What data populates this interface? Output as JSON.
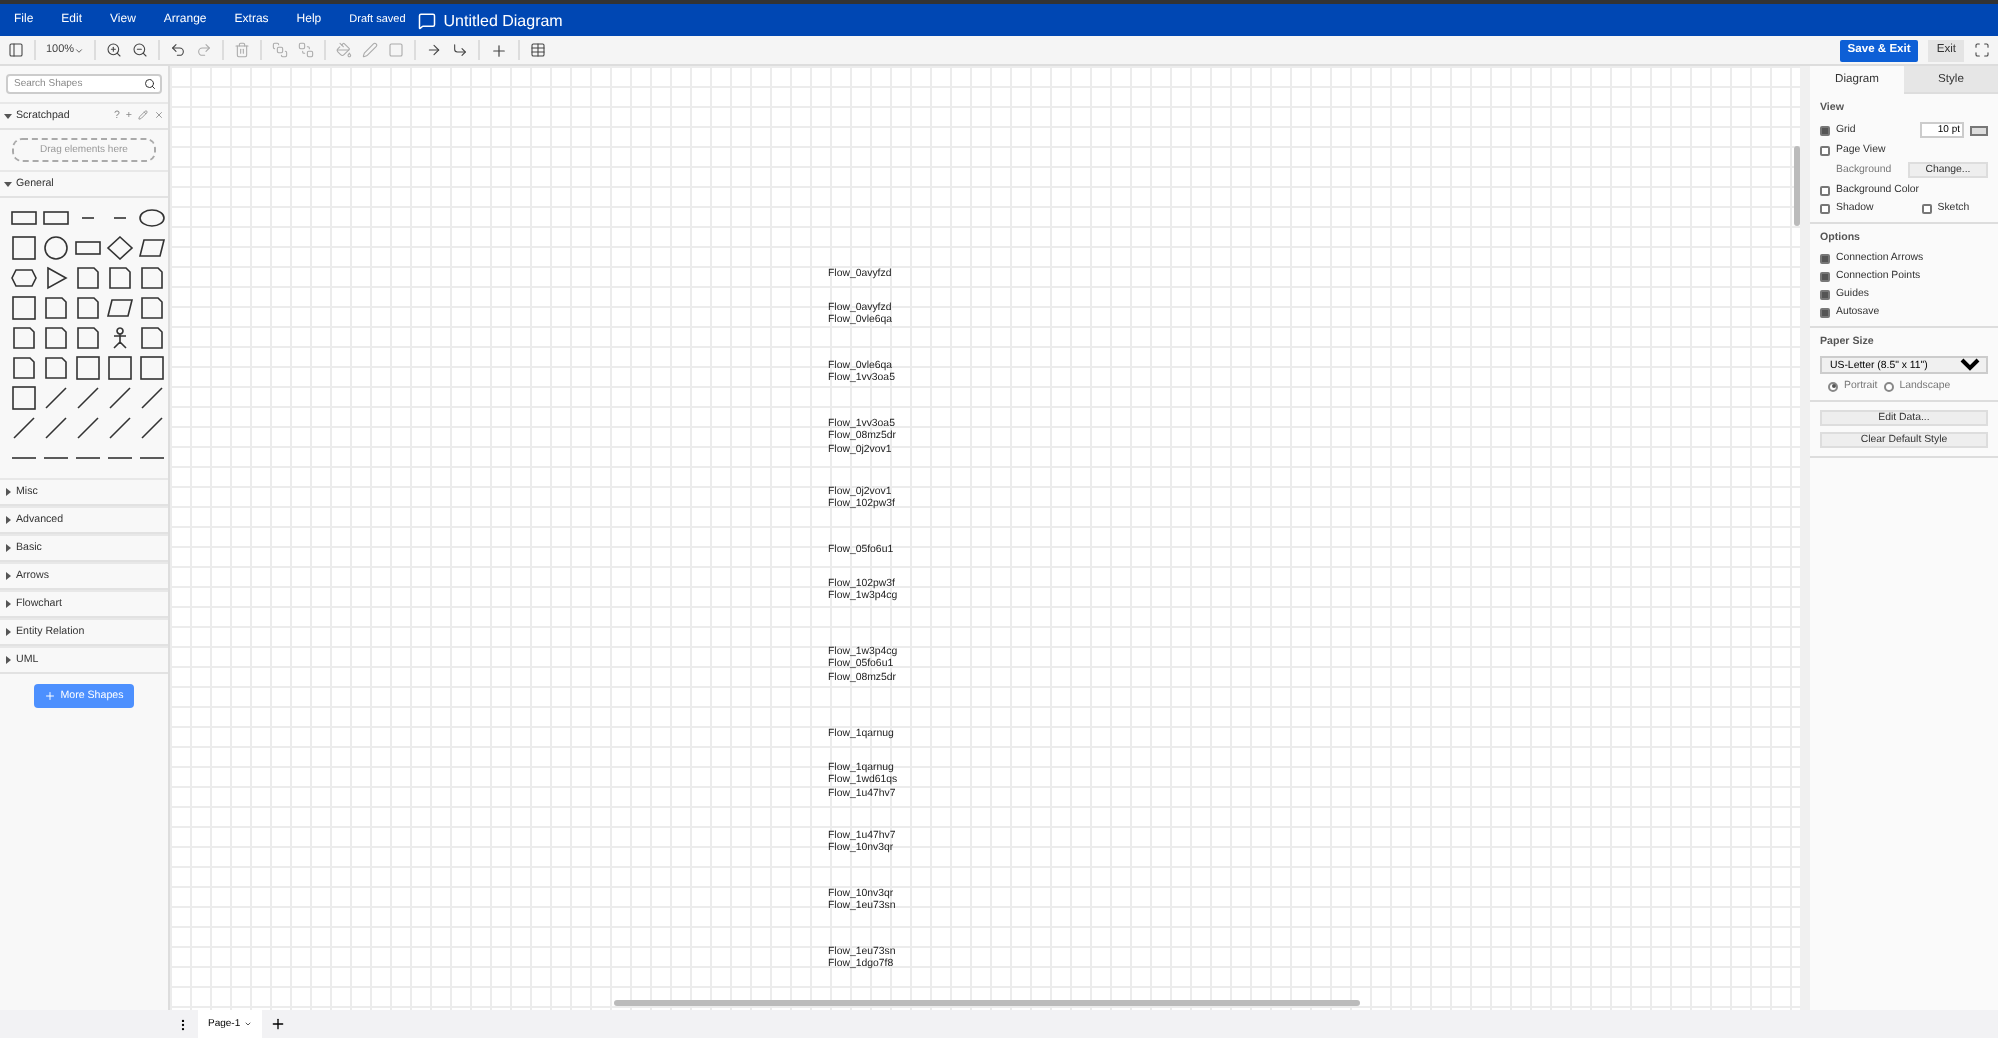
{
  "menubar": {
    "menus": [
      "File",
      "Edit",
      "View",
      "Arrange",
      "Extras",
      "Help"
    ],
    "status": "Draft saved",
    "title": "Untitled Diagram"
  },
  "toolbar": {
    "zoom": "100%",
    "save_button": "Save & Exit",
    "exit_button": "Exit"
  },
  "sidebar": {
    "search": {
      "placeholder": "Search Shapes"
    },
    "scratchpad": {
      "title": "Scratchpad",
      "expanded": true,
      "help": "?",
      "add": "+",
      "drop_hint": "Drag elements here"
    },
    "sections": [
      {
        "title": "General",
        "expanded": true
      },
      {
        "title": "Misc",
        "expanded": false
      },
      {
        "title": "Advanced",
        "expanded": false
      },
      {
        "title": "Basic",
        "expanded": false
      },
      {
        "title": "Arrows",
        "expanded": false
      },
      {
        "title": "Flowchart",
        "expanded": false
      },
      {
        "title": "Entity Relation",
        "expanded": false
      },
      {
        "title": "UML",
        "expanded": false
      }
    ],
    "more_shapes": "More Shapes"
  },
  "canvas": {
    "labels": [
      [
        "Flow_0avyfzd"
      ],
      [
        "Flow_0avyfzd",
        "Flow_0vle6qa"
      ],
      [
        "Flow_0vle6qa",
        "Flow_1vv3oa5"
      ],
      [
        "Flow_1vv3oa5",
        "Flow_08mz5dr",
        "Flow_0j2vov1"
      ],
      [
        "Flow_0j2vov1",
        "Flow_102pw3f"
      ],
      [
        "Flow_05fo6u1"
      ],
      [
        "Flow_102pw3f",
        "Flow_1w3p4cg"
      ],
      [
        "Flow_1w3p4cg",
        "Flow_05fo6u1",
        "Flow_08mz5dr"
      ],
      [
        "Flow_1qarnug"
      ],
      [
        "Flow_1qarnug",
        "Flow_1wd61qs",
        "Flow_1u47hv7"
      ],
      [
        "Flow_1u47hv7",
        "Flow_10nv3qr"
      ],
      [
        "Flow_10nv3qr",
        "Flow_1eu73sn"
      ],
      [
        "Flow_1eu73sn",
        "Flow_1dgo7f8"
      ]
    ]
  },
  "format_panel": {
    "tabs": [
      {
        "label": "Diagram",
        "selected": true
      },
      {
        "label": "Style",
        "selected": false
      }
    ],
    "view": {
      "title": "View",
      "grid": {
        "label": "Grid",
        "checked": true,
        "size": "10 pt"
      },
      "page_view": {
        "label": "Page View",
        "checked": false
      },
      "background": {
        "label": "Background",
        "button": "Change..."
      },
      "background_color": {
        "label": "Background Color",
        "checked": false
      },
      "shadow": {
        "label": "Shadow",
        "checked": false
      },
      "sketch": {
        "label": "Sketch",
        "checked": false
      }
    },
    "options": {
      "title": "Options",
      "items": [
        {
          "label": "Connection Arrows",
          "checked": true
        },
        {
          "label": "Connection Points",
          "checked": true
        },
        {
          "label": "Guides",
          "checked": true
        },
        {
          "label": "Autosave",
          "checked": true
        }
      ]
    },
    "paper_size": {
      "title": "Paper Size",
      "value": "US-Letter (8.5\" x 11\")",
      "orientations": [
        {
          "label": "Portrait",
          "selected": true
        },
        {
          "label": "Landscape",
          "selected": false
        }
      ]
    },
    "buttons": [
      "Edit Data...",
      "Clear Default Style"
    ]
  },
  "page_tabs": [
    {
      "label": "Page-1",
      "selected": true
    }
  ]
}
